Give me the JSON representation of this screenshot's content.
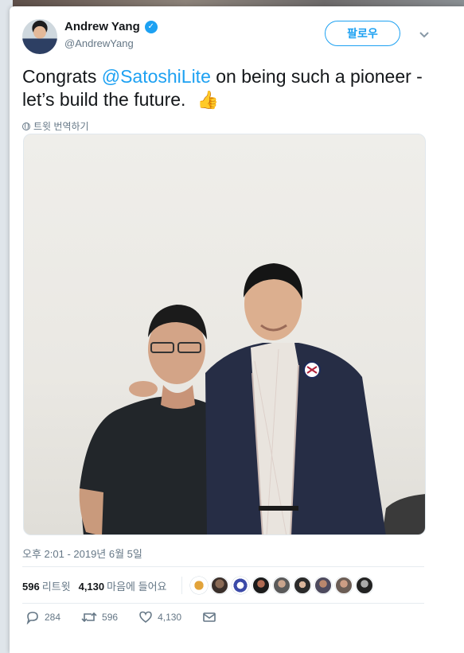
{
  "tweet": {
    "author": {
      "display_name": "Andrew Yang",
      "handle": "@AndrewYang",
      "verified": true
    },
    "follow_label": "팔로우",
    "text_before": "Congrats ",
    "mention": "@SatoshiLite",
    "text_after": " on being such a pioneer - let’s build the future.",
    "emoji": "👍",
    "translate_label": "트윗 번역하기",
    "timestamp": "오후 2:01 - 2019년 6월 5일",
    "stats": {
      "retweets_count": "596",
      "retweets_label": "리트윗",
      "likes_count": "4,130",
      "likes_label": "마음에 들어요"
    },
    "actions": {
      "reply_count": "284",
      "retweet_count": "596",
      "like_count": "4,130"
    }
  },
  "colors": {
    "accent": "#1da1f2",
    "secondary_text": "#657786"
  },
  "icons": [
    "verified-icon",
    "chevron-down-icon",
    "globe-icon",
    "reply-icon",
    "retweet-icon",
    "heart-icon",
    "mail-icon"
  ]
}
